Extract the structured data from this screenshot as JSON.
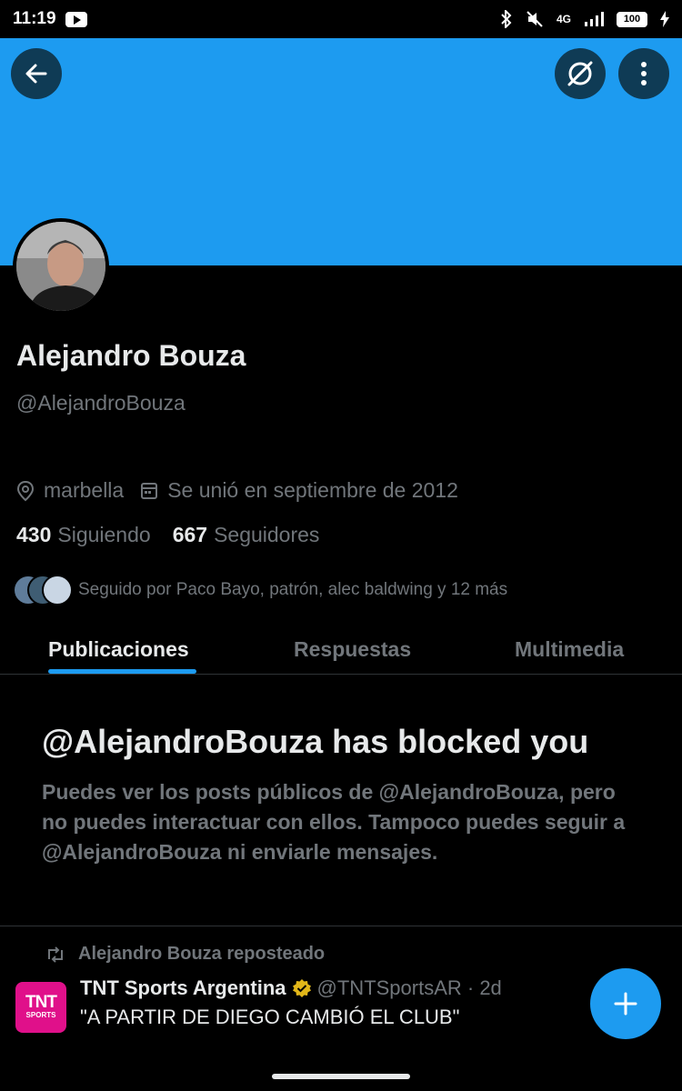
{
  "status_bar": {
    "time": "11:19",
    "network": "4G",
    "battery": "100"
  },
  "profile": {
    "banner_color": "#1d9bf0",
    "name": "Alejandro Bouza",
    "handle": "@AlejandroBouza",
    "location": "marbella",
    "joined": "Se unió en septiembre de 2012",
    "following_count": "430",
    "following_label": "Siguiendo",
    "followers_count": "667",
    "followers_label": "Seguidores",
    "followed_by": "Seguido por Paco Bayo, patrón, alec baldwing y 12 más"
  },
  "tabs": [
    {
      "label": "Publicaciones",
      "active": true
    },
    {
      "label": "Respuestas",
      "active": false
    },
    {
      "label": "Multimedia",
      "active": false
    }
  ],
  "blocked": {
    "title": "@AlejandroBouza has blocked you",
    "description": "Puedes ver los posts públicos de @AlejandroBouza, pero no puedes interactuar con ellos. Tampoco puedes seguir a @AlejandroBouza ni enviarle mensajes."
  },
  "tweet": {
    "repost_label": "Alejandro Bouza reposteado",
    "avatar_text_main": "TNT",
    "avatar_text_sub": "SPORTS",
    "author": "TNT Sports Argentina",
    "handle_time": "@TNTSportsAR · 2d",
    "text": "\"A PARTIR DE DIEGO CAMBIÓ EL CLUB\""
  },
  "icons": {
    "back": "arrow-left-icon",
    "grok": "grok-icon",
    "more": "more-vertical-icon",
    "location": "location-pin-icon",
    "calendar": "calendar-icon",
    "repost": "repost-icon",
    "verified": "verified-badge-icon",
    "compose": "plus-icon"
  },
  "colors": {
    "accent": "#1d9bf0",
    "verified_gold": "#e2b719",
    "tnt_brand": "#e0108a"
  }
}
